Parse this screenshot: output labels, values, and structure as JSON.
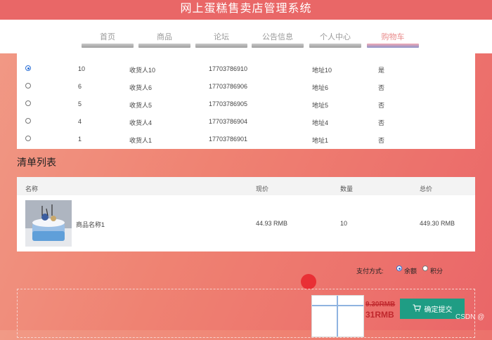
{
  "app": {
    "title": "网上蛋糕售卖店管理系统"
  },
  "nav": {
    "items": [
      {
        "label": "首页"
      },
      {
        "label": "商品"
      },
      {
        "label": "论坛"
      },
      {
        "label": "公告信息"
      },
      {
        "label": "个人中心"
      },
      {
        "label": "购物车",
        "active": true
      }
    ]
  },
  "addresses": {
    "rows": [
      {
        "selected": true,
        "id": "10",
        "name": "收货人10",
        "phone": "17703786910",
        "address": "地址10",
        "is_default": "是"
      },
      {
        "selected": false,
        "id": "6",
        "name": "收货人6",
        "phone": "17703786906",
        "address": "地址6",
        "is_default": "否"
      },
      {
        "selected": false,
        "id": "5",
        "name": "收货人5",
        "phone": "17703786905",
        "address": "地址5",
        "is_default": "否"
      },
      {
        "selected": false,
        "id": "4",
        "name": "收货人4",
        "phone": "17703786904",
        "address": "地址4",
        "is_default": "否"
      },
      {
        "selected": false,
        "id": "1",
        "name": "收货人1",
        "phone": "17703786901",
        "address": "地址1",
        "is_default": "否"
      }
    ]
  },
  "order_list": {
    "title": "清单列表",
    "headers": {
      "name": "名称",
      "price": "现价",
      "qty": "数量",
      "total": "总价"
    },
    "items": [
      {
        "name": "商品名称1",
        "price": "44.93 RMB",
        "qty": "10",
        "total": "449.30 RMB"
      }
    ]
  },
  "payment": {
    "label": "支付方式:",
    "options": [
      {
        "label": "余额",
        "selected": true
      },
      {
        "label": "积分",
        "selected": false
      }
    ]
  },
  "checkout": {
    "original_price": "9.30RMB",
    "final_price": "31RMB",
    "submit_label": "确定提交"
  },
  "watermark": "CSDN @",
  "colors": {
    "header": "#e96767",
    "accent_blue": "#2b6fd6",
    "submit_green": "#1f9d84",
    "price_red": "#c0282d"
  }
}
